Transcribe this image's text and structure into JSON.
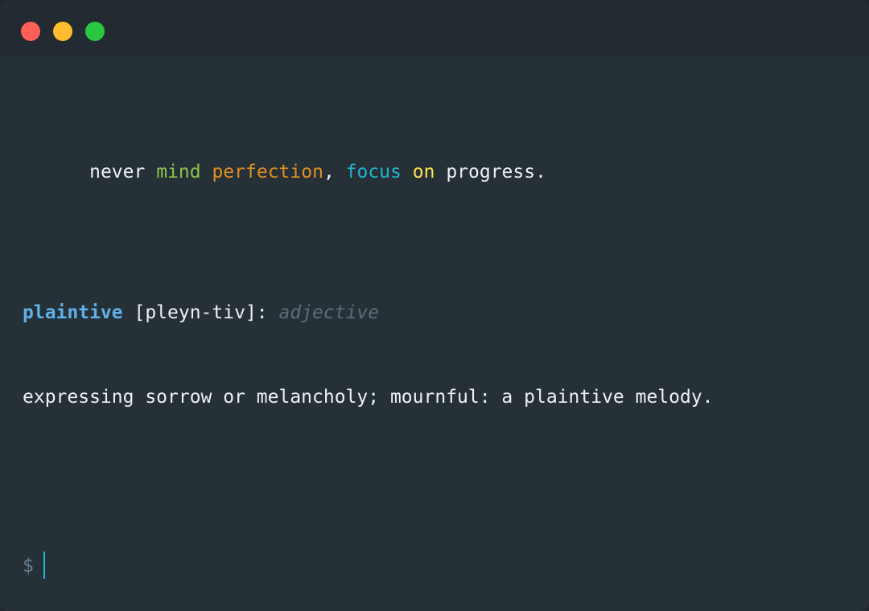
{
  "window": {
    "traffic_lights": {
      "close_color": "#ff5f57",
      "minimize_color": "#febc2e",
      "zoom_color": "#28c840"
    }
  },
  "terminal": {
    "quote": [
      {
        "text": "never",
        "color": "#eef1f4"
      },
      {
        "text": " ",
        "color": "#eef1f4"
      },
      {
        "text": "mind",
        "color": "#8bc34a"
      },
      {
        "text": " ",
        "color": "#eef1f4"
      },
      {
        "text": "perfection",
        "color": "#e08f21"
      },
      {
        "text": ", ",
        "color": "#eef1f4"
      },
      {
        "text": "focus",
        "color": "#26b4d2"
      },
      {
        "text": " ",
        "color": "#eef1f4"
      },
      {
        "text": "on",
        "color": "#ffe44d"
      },
      {
        "text": " ",
        "color": "#eef1f4"
      },
      {
        "text": "progress.",
        "color": "#eef1f4"
      }
    ],
    "definition": {
      "word": "plaintive",
      "word_color": "#5fb1ea",
      "pronunciation": " [pleyn-tiv]: ",
      "part_of_speech": "adjective",
      "part_of_speech_color": "#5b6e7a",
      "meaning": "expressing sorrow or melancholy; mournful: a plaintive melody."
    },
    "prompt": {
      "symbol": "$",
      "symbol_color": "#66808d",
      "cursor_color": "#26b4d2"
    }
  }
}
